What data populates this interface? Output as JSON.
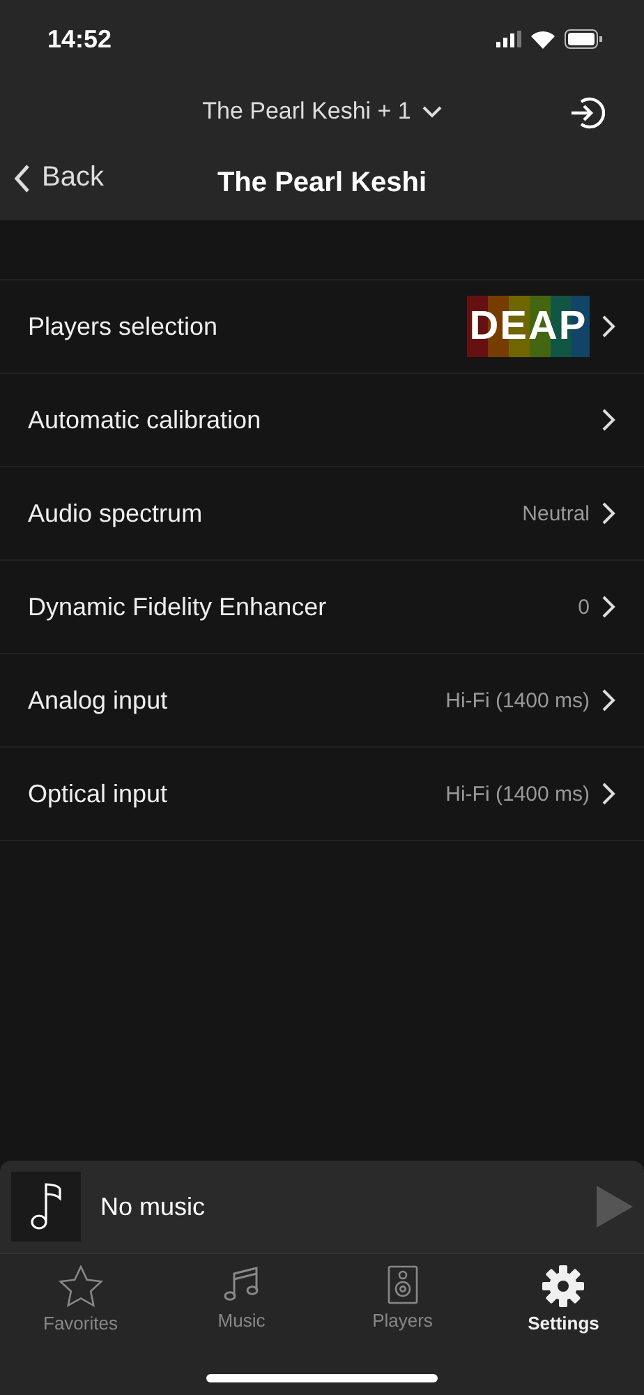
{
  "status_bar": {
    "time": "14:52"
  },
  "header": {
    "room": "The Pearl Keshi + 1",
    "title": "The Pearl Keshi",
    "back": "Back"
  },
  "settings": [
    {
      "label": "Players selection",
      "kind": "logo",
      "logo": {
        "title": "DEAP"
      }
    },
    {
      "label": "Automatic calibration",
      "kind": "value"
    },
    {
      "label": "Audio spectrum",
      "kind": "value",
      "value": "Neutral"
    },
    {
      "label": "Dynamic Fidelity Enhancer",
      "kind": "value",
      "value": "0"
    },
    {
      "label": "Analog input",
      "kind": "value",
      "value": "Hi-Fi (1400 ms)"
    },
    {
      "label": "Optical input",
      "kind": "value",
      "value": "Hi-Fi (1400 ms)"
    }
  ],
  "now_playing": {
    "title": "No music"
  },
  "tabs": [
    {
      "label": "Favorites",
      "kind": "star",
      "selected": false
    },
    {
      "label": "Music",
      "kind": "music",
      "selected": false
    },
    {
      "label": "Players",
      "kind": "speaker",
      "selected": false
    },
    {
      "label": "Settings",
      "kind": "gear",
      "selected": true
    }
  ]
}
